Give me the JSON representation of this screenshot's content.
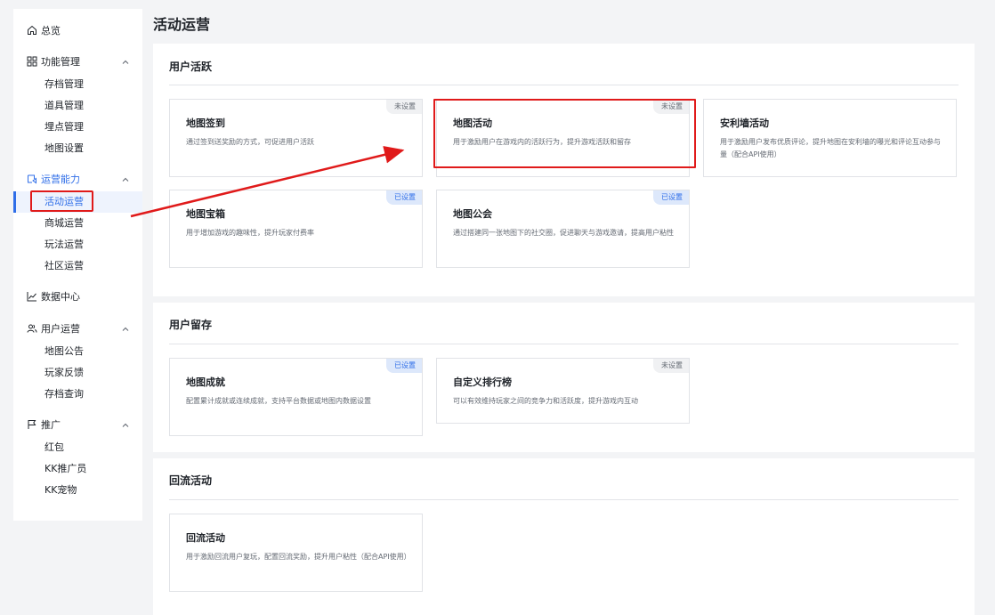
{
  "sidebar": {
    "overview": "总览",
    "groups": [
      {
        "label": "功能管理",
        "items": [
          "存档管理",
          "道具管理",
          "埋点管理",
          "地图设置"
        ]
      },
      {
        "label": "运营能力",
        "items": [
          "活动运营",
          "商城运营",
          "玩法运营",
          "社区运营"
        ]
      },
      {
        "label": "数据中心",
        "items": []
      },
      {
        "label": "用户运营",
        "items": [
          "地图公告",
          "玩家反馈",
          "存档查询"
        ]
      },
      {
        "label": "推广",
        "items": [
          "红包",
          "KK推广员",
          "KK宠物"
        ]
      }
    ],
    "active_item": "活动运营"
  },
  "main": {
    "title": "活动运营",
    "sections": [
      {
        "title": "用户活跃",
        "cards": [
          {
            "title": "地图签到",
            "desc": "通过签到送奖励的方式，可促进用户活跃",
            "badge": "未设置",
            "status": "unset"
          },
          {
            "title": "地图活动",
            "desc": "用于激励用户在游戏内的活跃行为，提升游戏活跃和留存",
            "badge": "未设置",
            "status": "unset"
          },
          {
            "title": "安利墙活动",
            "desc": "用于激励用户发布优质评论，提升地图在安利墙的曝光和评论互动参与量（配合API使用）",
            "badge": "",
            "status": "none"
          },
          {
            "title": "地图宝箱",
            "desc": "用于增加游戏的趣味性，提升玩家付费率",
            "badge": "已设置",
            "status": "set"
          },
          {
            "title": "地图公会",
            "desc": "通过搭建同一张地图下的社交圈，促进聊天与游戏邀请，提高用户粘性",
            "badge": "已设置",
            "status": "set"
          }
        ]
      },
      {
        "title": "用户留存",
        "cards": [
          {
            "title": "地图成就",
            "desc": "配置累计成就或连续成就，支持平台数据或地图内数据设置",
            "badge": "已设置",
            "status": "set"
          },
          {
            "title": "自定义排行榜",
            "desc": "可以有效维持玩家之间的竞争力和活跃度，提升游戏内互动",
            "badge": "未设置",
            "status": "unset"
          }
        ]
      },
      {
        "title": "回流活动",
        "cards": [
          {
            "title": "回流活动",
            "desc": "用于激励回流用户复玩，配置回流奖励，提升用户粘性（配合API使用）",
            "badge": "",
            "status": "none"
          }
        ]
      }
    ]
  },
  "colors": {
    "accent": "#2f6ee8",
    "annotation_red": "#e01a1a"
  },
  "icons": [
    "home-icon",
    "grid-icon",
    "megaphone-box-icon",
    "chart-line-icon",
    "users-icon",
    "flag-icon",
    "chevron-up-icon"
  ]
}
